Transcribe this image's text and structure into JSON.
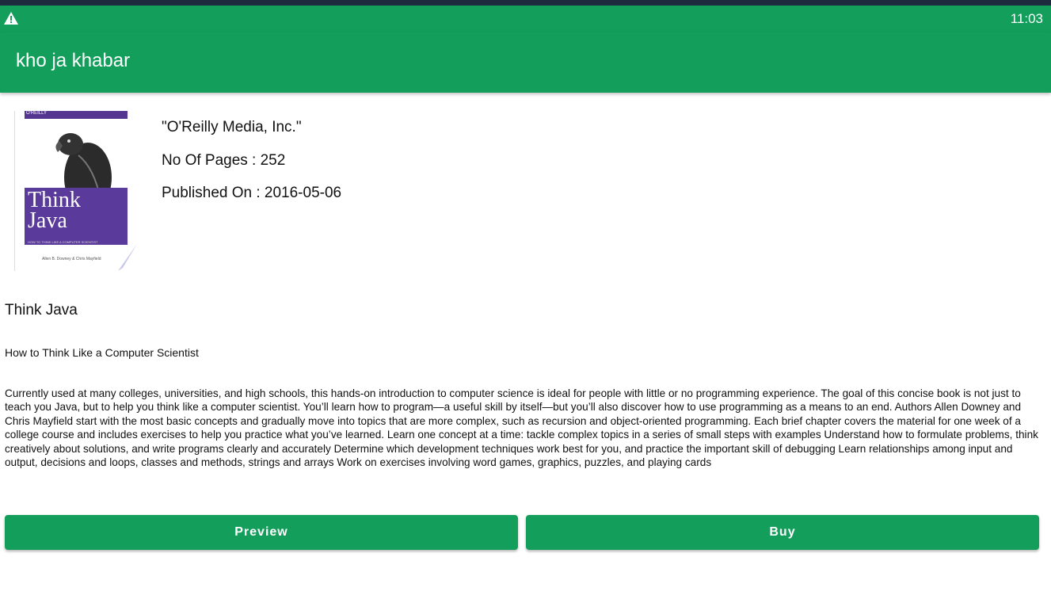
{
  "status_bar": {
    "time": "11:03",
    "warning_icon": "warning-icon"
  },
  "app_bar": {
    "title": "kho ja khabar"
  },
  "cover": {
    "publisher_label": "O'REILLY",
    "title_line1": "Think",
    "title_line2": "Java",
    "subtitle": "HOW TO THINK LIKE A COMPUTER SCIENTIST",
    "authors": "Allen B. Downey & Chris Mayfield"
  },
  "book": {
    "publisher": "\"O'Reilly Media, Inc.\"",
    "pages": "No Of Pages : 252",
    "published": "Published On : 2016-05-06",
    "title": "Think Java",
    "subtitle": "How to Think Like a Computer Scientist",
    "description": "Currently used at many colleges, universities, and high schools, this hands-on introduction to computer science is ideal for people with little or no programming experience. The goal of this concise book is not just to teach you Java, but to help you think like a computer scientist. You’ll learn how to program—a useful skill by itself—but you’ll also discover how to use programming as a means to an end. Authors Allen Downey and Chris Mayfield start with the most basic concepts and gradually move into topics that are more complex, such as recursion and object-oriented programming. Each brief chapter covers the material for one week of a college course and includes exercises to help you practice what you’ve learned. Learn one concept at a time: tackle complex topics in a series of small steps with examples Understand how to formulate problems, think creatively about solutions, and write programs clearly and accurately Determine which development techniques work best for you, and practice the important skill of debugging Learn relationships among input and output, decisions and loops, classes and methods, strings and arrays Work on exercises involving word games, graphics, puzzles, and playing cards"
  },
  "actions": {
    "preview_label": "Preview",
    "buy_label": "Buy"
  },
  "colors": {
    "primary": "#139f5b",
    "top_strip": "#1e2a3e",
    "cover_purple": "#5a3a9b"
  }
}
